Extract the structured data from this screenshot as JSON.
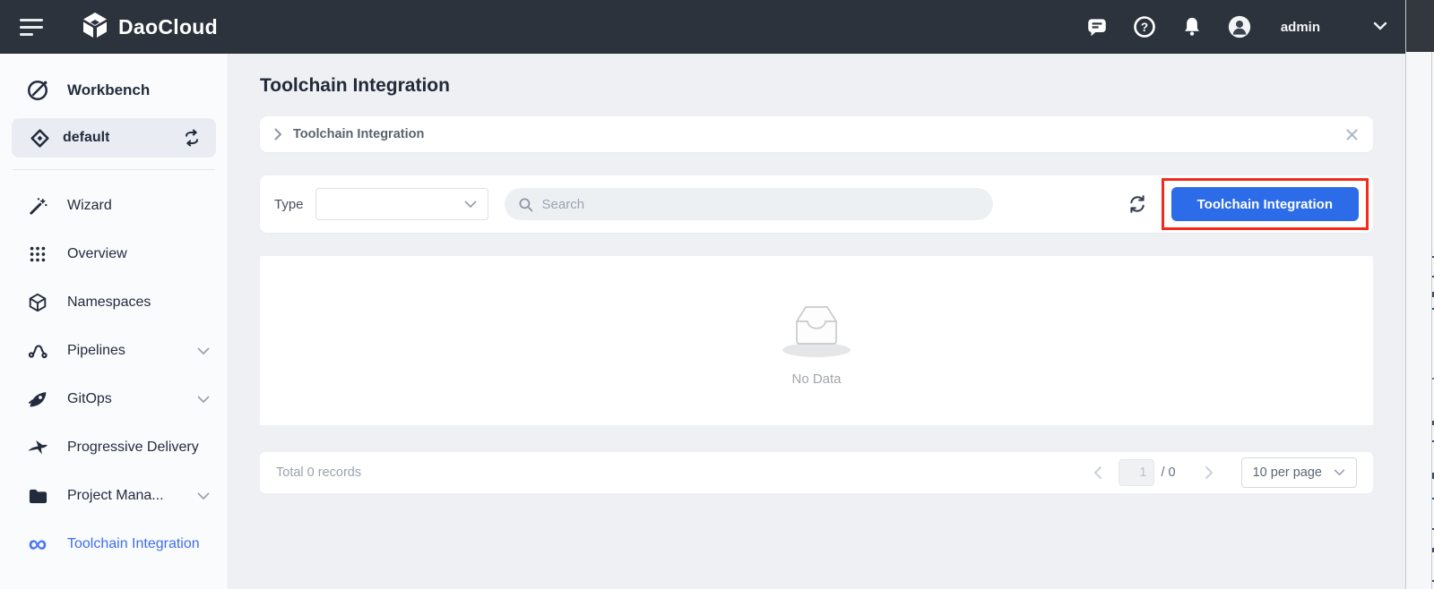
{
  "header": {
    "brand": "DaoCloud",
    "username": "admin"
  },
  "sidebar": {
    "items": [
      {
        "label": "Workbench"
      },
      {
        "label": "default"
      },
      {
        "label": "Wizard"
      },
      {
        "label": "Overview"
      },
      {
        "label": "Namespaces"
      },
      {
        "label": "Pipelines"
      },
      {
        "label": "GitOps"
      },
      {
        "label": "Progressive Delivery"
      },
      {
        "label": "Project Mana..."
      },
      {
        "label": "Toolchain Integration"
      }
    ]
  },
  "page": {
    "title": "Toolchain Integration"
  },
  "breadcrumb": {
    "item": "Toolchain Integration"
  },
  "toolbar": {
    "type_label": "Type",
    "search_placeholder": "Search",
    "action_button": "Toolchain Integration"
  },
  "empty_state": {
    "message": "No Data"
  },
  "pagination": {
    "total": "Total 0 records",
    "page_value": "1",
    "page_suffix": "/ 0",
    "page_size": "10 per page"
  },
  "colors": {
    "header_bg": "#2c333c",
    "accent_blue": "#2d6ce8",
    "highlight_red": "#f5291c",
    "active_link": "#3d6ef2"
  }
}
